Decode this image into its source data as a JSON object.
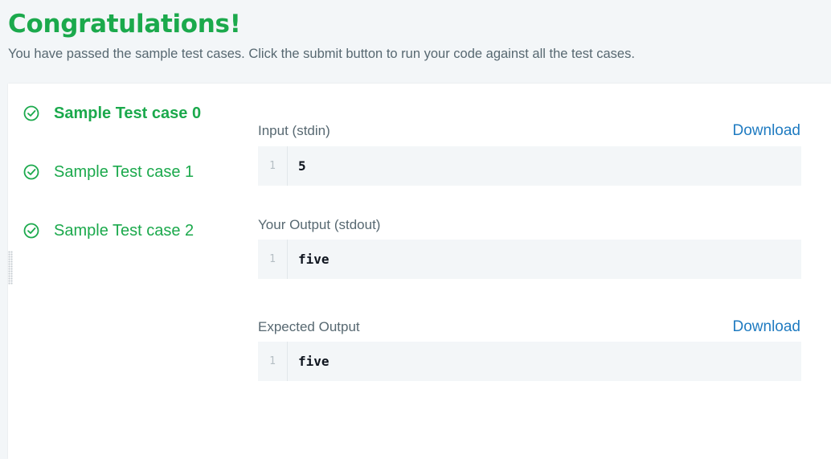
{
  "header": {
    "title": "Congratulations!",
    "subtitle": "You have passed the sample test cases. Click the submit button to run your code against all the test cases."
  },
  "colors": {
    "success": "#1ba94c",
    "link": "#1f7bc1",
    "text": "#576871"
  },
  "test_cases": [
    {
      "label": "Sample Test case 0",
      "icon": "check-circle-icon",
      "active": true
    },
    {
      "label": "Sample Test case 1",
      "icon": "check-circle-icon",
      "active": false
    },
    {
      "label": "Sample Test case 2",
      "icon": "check-circle-icon",
      "active": false
    }
  ],
  "details": {
    "input": {
      "label": "Input (stdin)",
      "download": "Download",
      "line_number": "1",
      "value": "5"
    },
    "output": {
      "label": "Your Output (stdout)",
      "line_number": "1",
      "value": "five"
    },
    "expected": {
      "label": "Expected Output",
      "download": "Download",
      "line_number": "1",
      "value": "five"
    }
  }
}
